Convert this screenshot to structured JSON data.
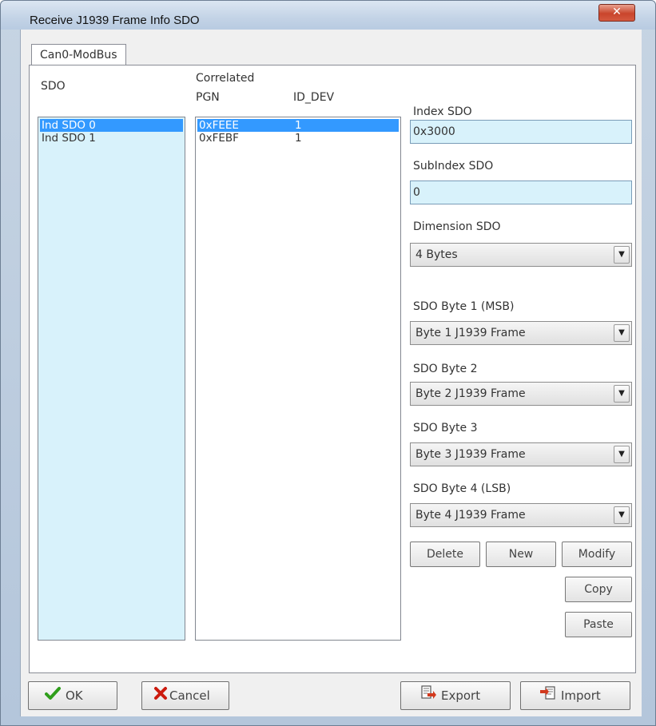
{
  "window": {
    "title": "Receive J1939 Frame Info SDO",
    "close_glyph": "✕"
  },
  "tabs": [
    {
      "label": "Can0-ModBus"
    }
  ],
  "sdo": {
    "header": "SDO",
    "items": [
      {
        "label": "Ind SDO 0",
        "selected": true
      },
      {
        "label": "Ind SDO 1",
        "selected": false
      }
    ]
  },
  "correlated": {
    "header": "Correlated",
    "col_pgn": "PGN",
    "col_iddev": "ID_DEV",
    "rows": [
      {
        "pgn": "0xFEEE",
        "id_dev": "1",
        "selected": true
      },
      {
        "pgn": "0xFEBF",
        "id_dev": "1",
        "selected": false
      }
    ]
  },
  "form": {
    "index_label": "Index SDO",
    "index_value": "0x3000",
    "subindex_label": "SubIndex SDO",
    "subindex_value": "0",
    "dimension_label": "Dimension SDO",
    "dimension_value": "4 Bytes",
    "byte1_label": "SDO Byte 1 (MSB)",
    "byte1_value": "Byte 1 J1939 Frame",
    "byte2_label": "SDO Byte 2",
    "byte2_value": "Byte 2 J1939 Frame",
    "byte3_label": "SDO Byte 3",
    "byte3_value": "Byte 3 J1939 Frame",
    "byte4_label": "SDO Byte 4 (LSB)",
    "byte4_value": "Byte 4 J1939 Frame",
    "combo_arrow": "▼"
  },
  "actions": {
    "delete": "Delete",
    "new": "New",
    "modify": "Modify",
    "copy": "Copy",
    "paste": "Paste"
  },
  "footer": {
    "ok": "OK",
    "cancel": "Cancel",
    "export": "Export",
    "import": "Import"
  },
  "colors": {
    "selection": "#3399ff",
    "list_bg": "#d8f2fb",
    "ok_check": "#2f9e1b",
    "cancel_x": "#cc1b0e"
  },
  "icons": {
    "ok": "check-icon",
    "cancel": "x-icon",
    "export": "export-icon",
    "import": "import-icon"
  }
}
